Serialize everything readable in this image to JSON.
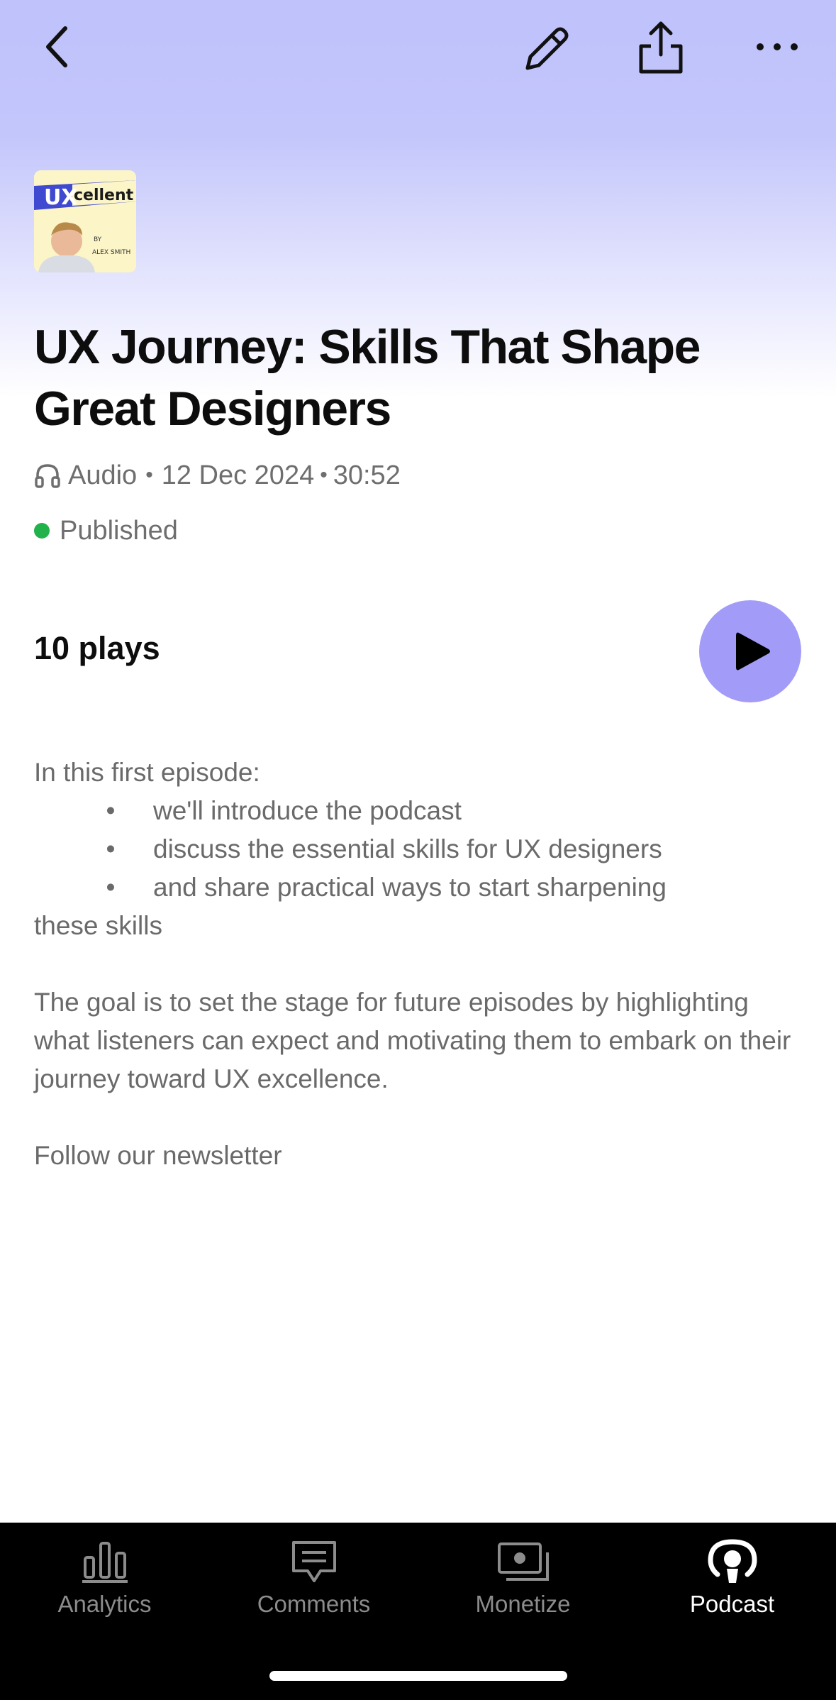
{
  "header": {
    "back_icon": "chevron-left-icon",
    "edit_icon": "pencil-icon",
    "share_icon": "share-icon",
    "more_icon": "more-horizontal-icon"
  },
  "cover": {
    "brand_prefix": "UX",
    "brand_suffix": "cellent",
    "by": "BY",
    "author": "ALEX SMITH"
  },
  "episode": {
    "title": "UX Journey: Skills That Shape Great Designers",
    "type": "Audio",
    "date": "12 Dec 2024",
    "duration": "30:52",
    "separator": "•",
    "status": "Published",
    "status_color": "#22b24c",
    "plays": "10 plays"
  },
  "description": {
    "intro": "In this first episode:",
    "bullets": [
      "we'll introduce the podcast",
      "discuss the essential skills for UX designers",
      "and share practical ways to start sharpening"
    ],
    "bullet_tail": "these skills",
    "paragraph": "The goal is to set the stage for future episodes by highlighting what listeners can expect and motivating them to embark on their journey toward UX excellence.",
    "follow": "Follow our newsletter"
  },
  "tabs": [
    {
      "label": "Analytics",
      "icon": "bar-chart-icon",
      "active": false
    },
    {
      "label": "Comments",
      "icon": "comment-icon",
      "active": false
    },
    {
      "label": "Monetize",
      "icon": "money-icon",
      "active": false
    },
    {
      "label": "Podcast",
      "icon": "podcast-icon",
      "active": true
    }
  ],
  "colors": {
    "accent": "#a29cf8",
    "hero_top": "#bfc2fb",
    "tabbar": "#000000"
  }
}
